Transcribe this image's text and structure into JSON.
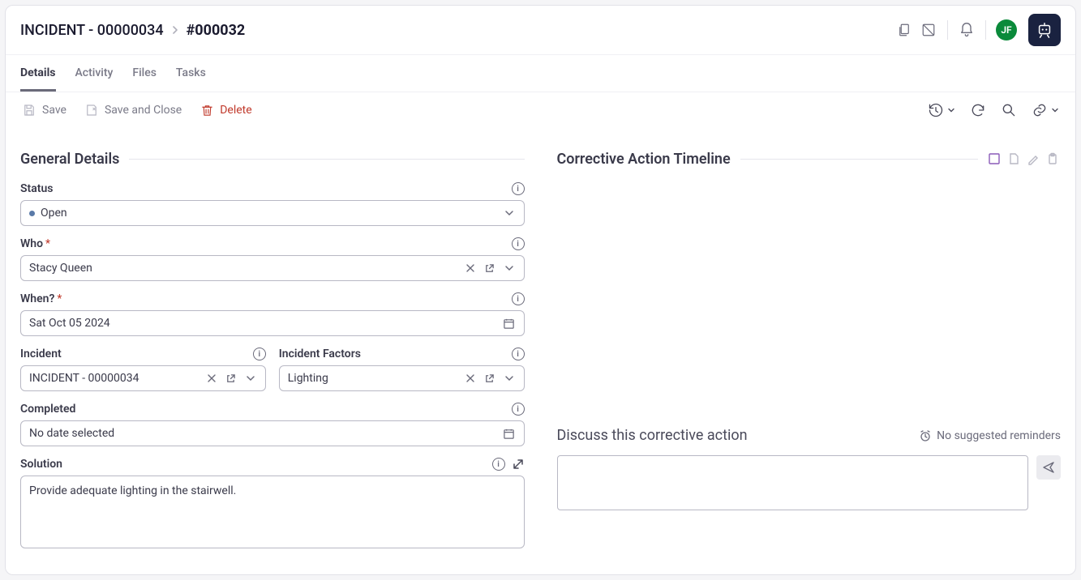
{
  "header": {
    "breadcrumb_parent": "INCIDENT - 00000034",
    "breadcrumb_current": "#000032",
    "avatar_initials": "JF"
  },
  "tabs": {
    "details": "Details",
    "activity": "Activity",
    "files": "Files",
    "tasks": "Tasks"
  },
  "toolbar": {
    "save": "Save",
    "save_close": "Save and Close",
    "delete": "Delete"
  },
  "sections": {
    "general": "General Details",
    "timeline": "Corrective Action Timeline"
  },
  "fields": {
    "status_label": "Status",
    "status_value": "Open",
    "who_label": "Who",
    "who_value": "Stacy Queen",
    "when_label": "When?",
    "when_value": "Sat Oct 05 2024",
    "incident_label": "Incident",
    "incident_value": "INCIDENT - 00000034",
    "factors_label": "Incident Factors",
    "factors_value": "Lighting",
    "completed_label": "Completed",
    "completed_value": "No date selected",
    "solution_label": "Solution",
    "solution_value": "Provide adequate lighting in the stairwell."
  },
  "discuss": {
    "title": "Discuss this corrective action",
    "reminders": "No suggested reminders"
  }
}
